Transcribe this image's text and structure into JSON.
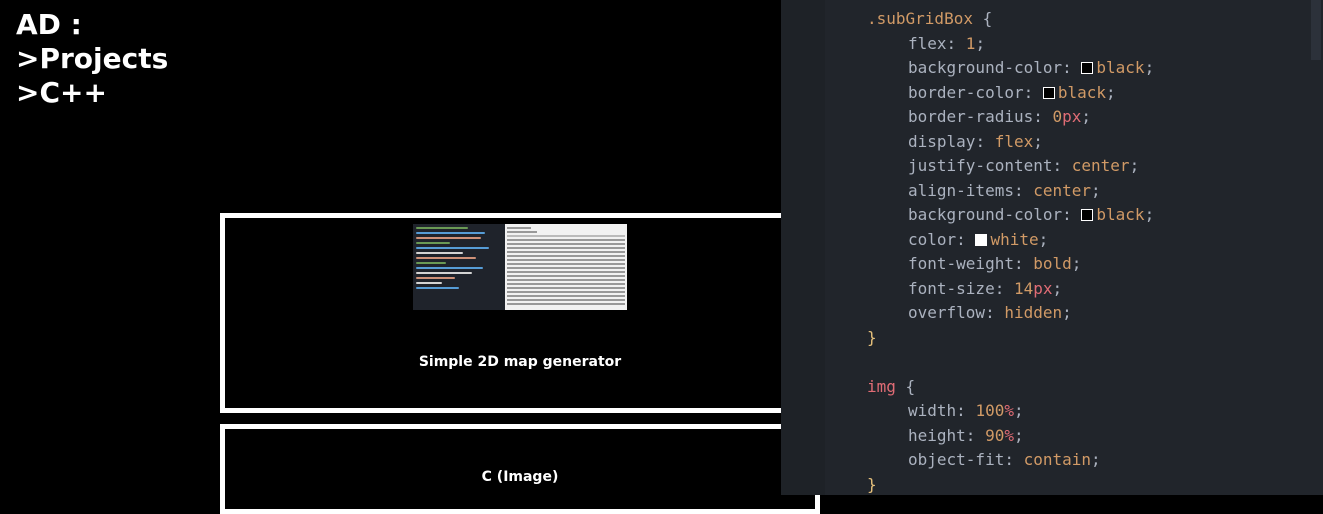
{
  "breadcrumb": {
    "lines": [
      "AD :",
      ">Projects",
      ">C++"
    ]
  },
  "cards": [
    {
      "title": "Simple 2D map generator",
      "has_thumbnail": true
    },
    {
      "title": "C (Image)",
      "has_thumbnail": false
    }
  ],
  "editor": {
    "selector_1": ".subGridBox",
    "rules_1": [
      {
        "prop": "flex",
        "value": "1"
      },
      {
        "prop": "background-color",
        "value": "black",
        "swatch": "#000000"
      },
      {
        "prop": "border-color",
        "value": "black",
        "swatch": "#000000"
      },
      {
        "prop": "border-radius",
        "value": "0px"
      },
      {
        "prop": "display",
        "value": "flex"
      },
      {
        "prop": "justify-content",
        "value": "center"
      },
      {
        "prop": "align-items",
        "value": "center"
      },
      {
        "prop": "background-color",
        "value": "black",
        "swatch": "#000000"
      },
      {
        "prop": "color",
        "value": "white",
        "swatch": "#ffffff"
      },
      {
        "prop": "font-weight",
        "value": "bold"
      },
      {
        "prop": "font-size",
        "value": "14px"
      },
      {
        "prop": "overflow",
        "value": "hidden"
      }
    ],
    "selector_2": "img",
    "rules_2": [
      {
        "prop": "width",
        "value": "100%"
      },
      {
        "prop": "height",
        "value": "90%"
      },
      {
        "prop": "object-fit",
        "value": "contain"
      }
    ]
  },
  "colors": {
    "editor_bg": "#21252b",
    "selector": "#d19a66",
    "tag": "#e06c75",
    "brace": "#e5c07b"
  }
}
